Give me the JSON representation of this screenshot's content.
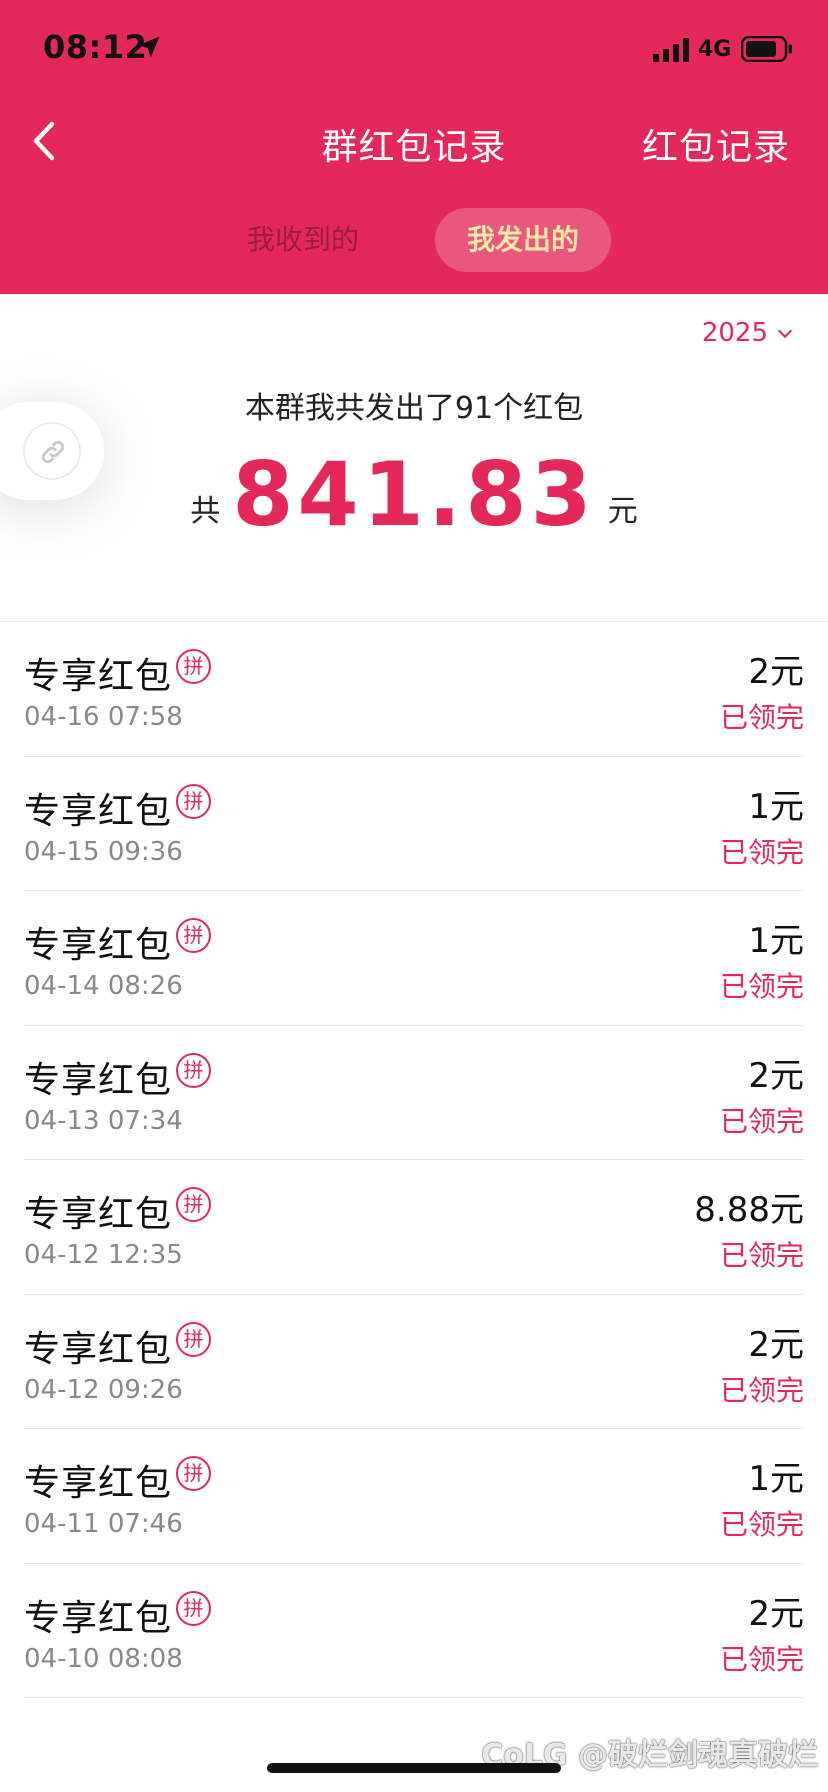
{
  "colors": {
    "brand_red": "#e5285a",
    "tab_active_text": "#ffe7a8"
  },
  "status_bar": {
    "time": "08:12",
    "network": "4G",
    "icons": [
      "location-arrow-icon",
      "signal-icon",
      "battery-icon"
    ]
  },
  "nav": {
    "back_icon": "chevron-left-icon",
    "title": "群红包记录",
    "right_action": "红包记录"
  },
  "tabs": [
    {
      "label": "我收到的",
      "active": false
    },
    {
      "label": "我发出的",
      "active": true
    }
  ],
  "year_selector": {
    "value": "2025",
    "icon": "chevron-down-icon"
  },
  "floating_button": {
    "icon": "link-icon"
  },
  "summary": {
    "description": "本群我共发出了91个红包",
    "total_prefix": "共",
    "total_amount": "841.83",
    "total_suffix": "元"
  },
  "records": [
    {
      "title": "专享红包",
      "badge": "拼",
      "time": "04-16 07:58",
      "amount": "2元",
      "status": "已领完"
    },
    {
      "title": "专享红包",
      "badge": "拼",
      "time": "04-15 09:36",
      "amount": "1元",
      "status": "已领完"
    },
    {
      "title": "专享红包",
      "badge": "拼",
      "time": "04-14 08:26",
      "amount": "1元",
      "status": "已领完"
    },
    {
      "title": "专享红包",
      "badge": "拼",
      "time": "04-13 07:34",
      "amount": "2元",
      "status": "已领完"
    },
    {
      "title": "专享红包",
      "badge": "拼",
      "time": "04-12 12:35",
      "amount": "8.88元",
      "status": "已领完"
    },
    {
      "title": "专享红包",
      "badge": "拼",
      "time": "04-12 09:26",
      "amount": "2元",
      "status": "已领完"
    },
    {
      "title": "专享红包",
      "badge": "拼",
      "time": "04-11 07:46",
      "amount": "1元",
      "status": "已领完"
    },
    {
      "title": "专享红包",
      "badge": "拼",
      "time": "04-10 08:08",
      "amount": "2元",
      "status": "已领完"
    }
  ],
  "watermark": "CoLG @破烂剑魂真破烂"
}
